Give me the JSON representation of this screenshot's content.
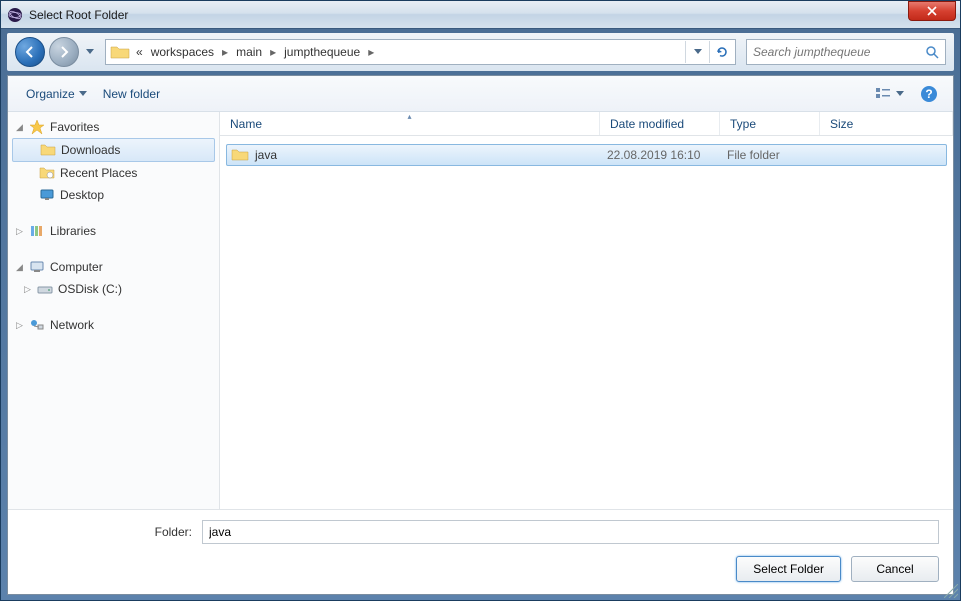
{
  "window": {
    "title": "Select Root Folder"
  },
  "nav": {
    "breadcrumb_prefix": "«",
    "breadcrumb": [
      "workspaces",
      "main",
      "jumpthequeue"
    ]
  },
  "search": {
    "placeholder": "Search jumpthequeue"
  },
  "toolbar": {
    "organize_label": "Organize",
    "newfolder_label": "New folder"
  },
  "sidebar": {
    "favorites": {
      "label": "Favorites",
      "items": [
        {
          "label": "Downloads"
        },
        {
          "label": "Recent Places"
        },
        {
          "label": "Desktop"
        }
      ]
    },
    "libraries": {
      "label": "Libraries"
    },
    "computer": {
      "label": "Computer",
      "items": [
        {
          "label": "OSDisk (C:)"
        }
      ]
    },
    "network": {
      "label": "Network"
    }
  },
  "columns": {
    "name": "Name",
    "date": "Date modified",
    "type": "Type",
    "size": "Size"
  },
  "files": [
    {
      "name": "java",
      "date": "22.08.2019 16:10",
      "type": "File folder",
      "size": ""
    }
  ],
  "bottom": {
    "folder_label": "Folder:",
    "folder_value": "java",
    "select_label": "Select Folder",
    "cancel_label": "Cancel"
  }
}
